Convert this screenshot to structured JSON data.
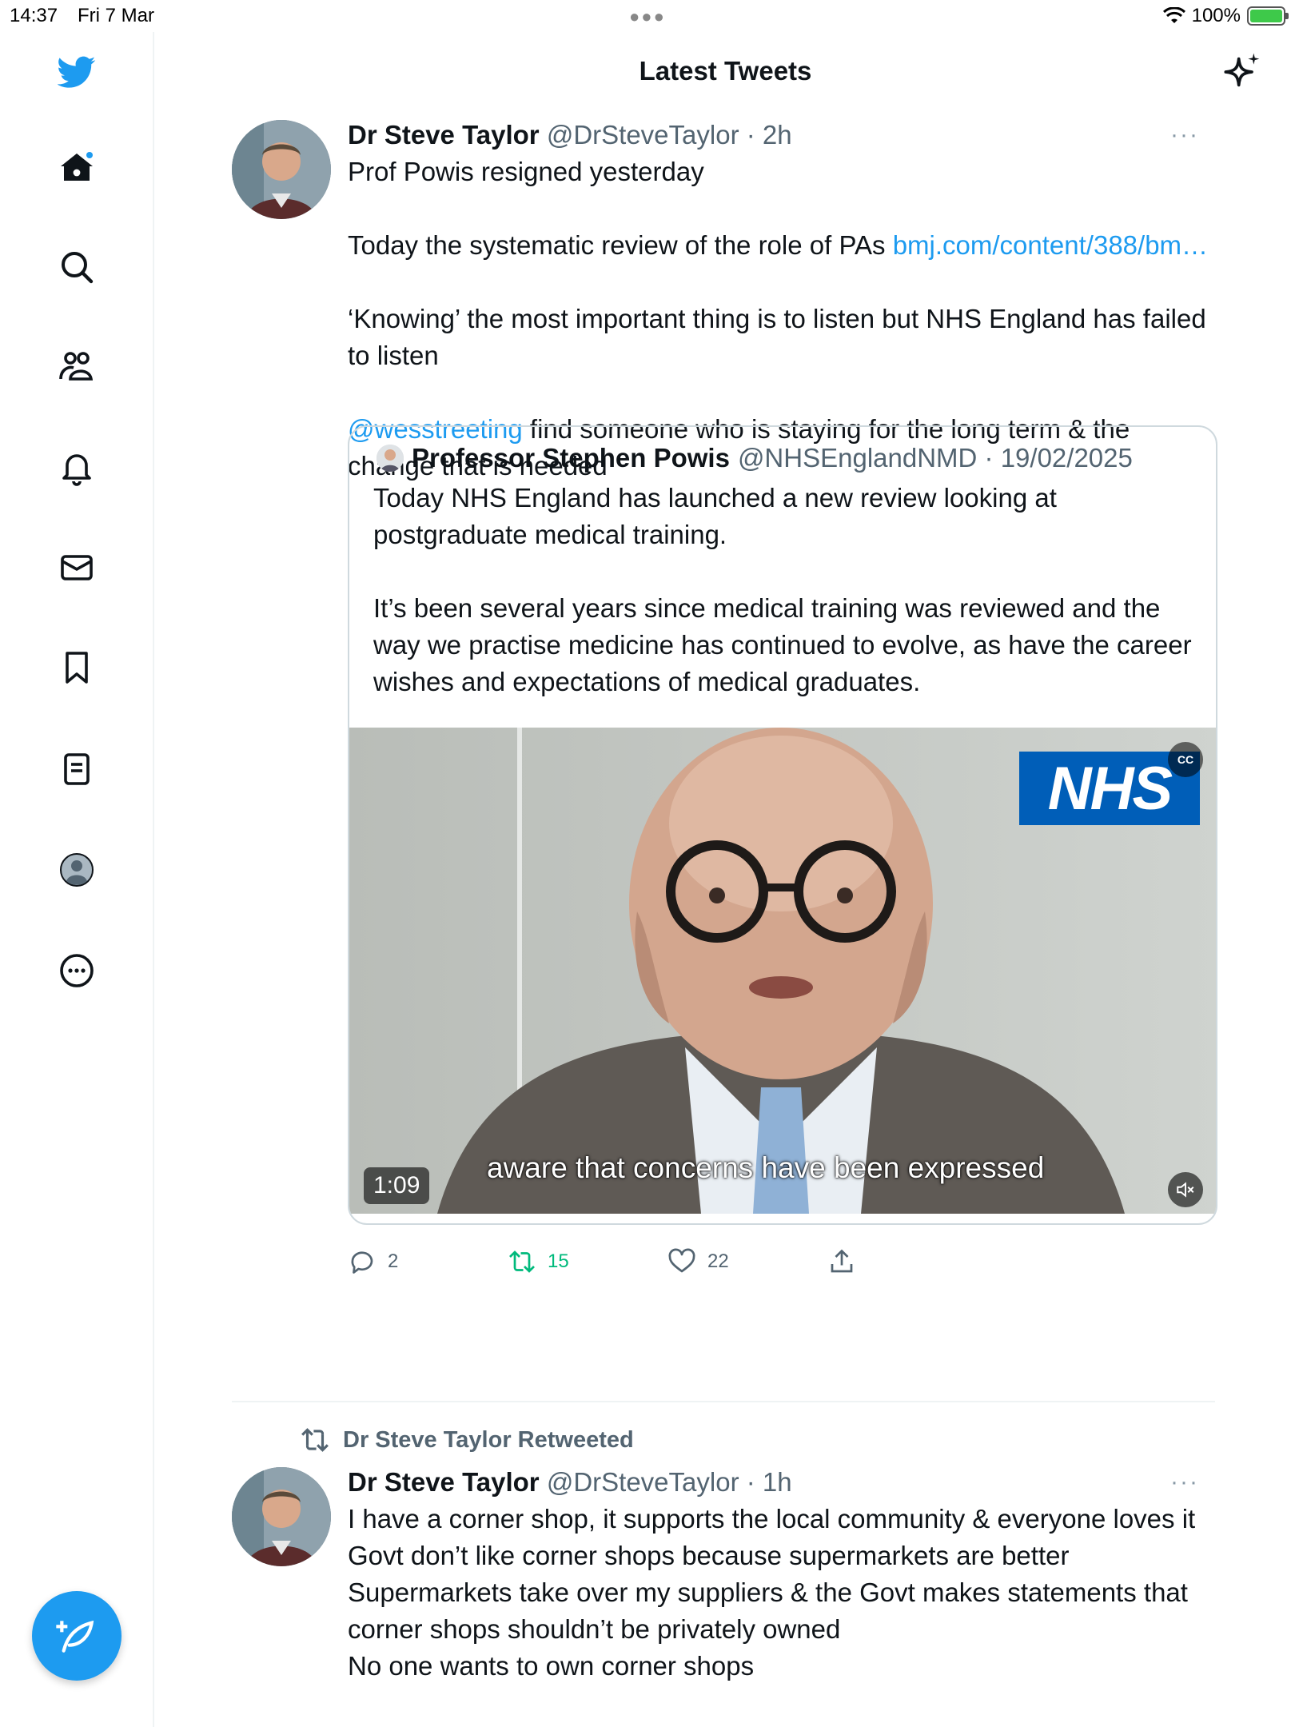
{
  "status_bar": {
    "time": "14:37",
    "date": "Fri 7 Mar",
    "battery": "100%"
  },
  "header": {
    "title": "Latest Tweets"
  },
  "sidebar": {
    "items": [
      "twitter-logo",
      "home-icon",
      "search-icon",
      "communities-icon",
      "notifications-icon",
      "messages-icon",
      "bookmarks-icon",
      "lists-icon",
      "profile-icon",
      "more-icon"
    ],
    "compose_icon": "compose-icon"
  },
  "tweet1": {
    "name": "Dr Steve Taylor",
    "handle": "@DrSteveTaylor · 2h",
    "more": "···",
    "p1": "Prof Powis resigned yesterday",
    "p2_text": "Today the systematic review of the role of PAs ",
    "p2_link": "bmj.com/content/388/bm…",
    "p3": "‘Knowing’ the most important thing is to listen but NHS England has failed to listen",
    "p4_link": "@wesstreeting",
    "p4_text": " find someone who is staying for the long term & the change that is needed",
    "quote": {
      "name": "Professor Stephen Powis",
      "handle": "@NHSEnglandNMD · 19/02/2025",
      "p1": "Today NHS England has launched a new review looking at postgraduate medical training.",
      "p2": "It’s been several years since medical training was reviewed and the way we practise medicine has continued to evolve, as have the career wishes and expectations of medical graduates.",
      "video": {
        "logo": "NHS",
        "caption": "aware that concerns have been expressed",
        "duration": "1:09"
      }
    },
    "replies": "2",
    "retweets": "15",
    "likes": "22"
  },
  "tweet2": {
    "retweeted_by": "Dr Steve Taylor Retweeted",
    "name": "Dr Steve Taylor",
    "handle": "@DrSteveTaylor · 1h",
    "more": "···",
    "line1": "I have a corner shop, it supports the local community & everyone loves it",
    "line2": "Govt don’t like corner shops because supermarkets are better",
    "line3": "Supermarkets take over my suppliers & the Govt makes statements that corner shops shouldn’t be privately owned",
    "line4": "No one wants to own corner shops"
  },
  "colors": {
    "accent": "#1d9bf0",
    "retweet": "#00ba7c",
    "nhs_blue": "#005eb8"
  }
}
